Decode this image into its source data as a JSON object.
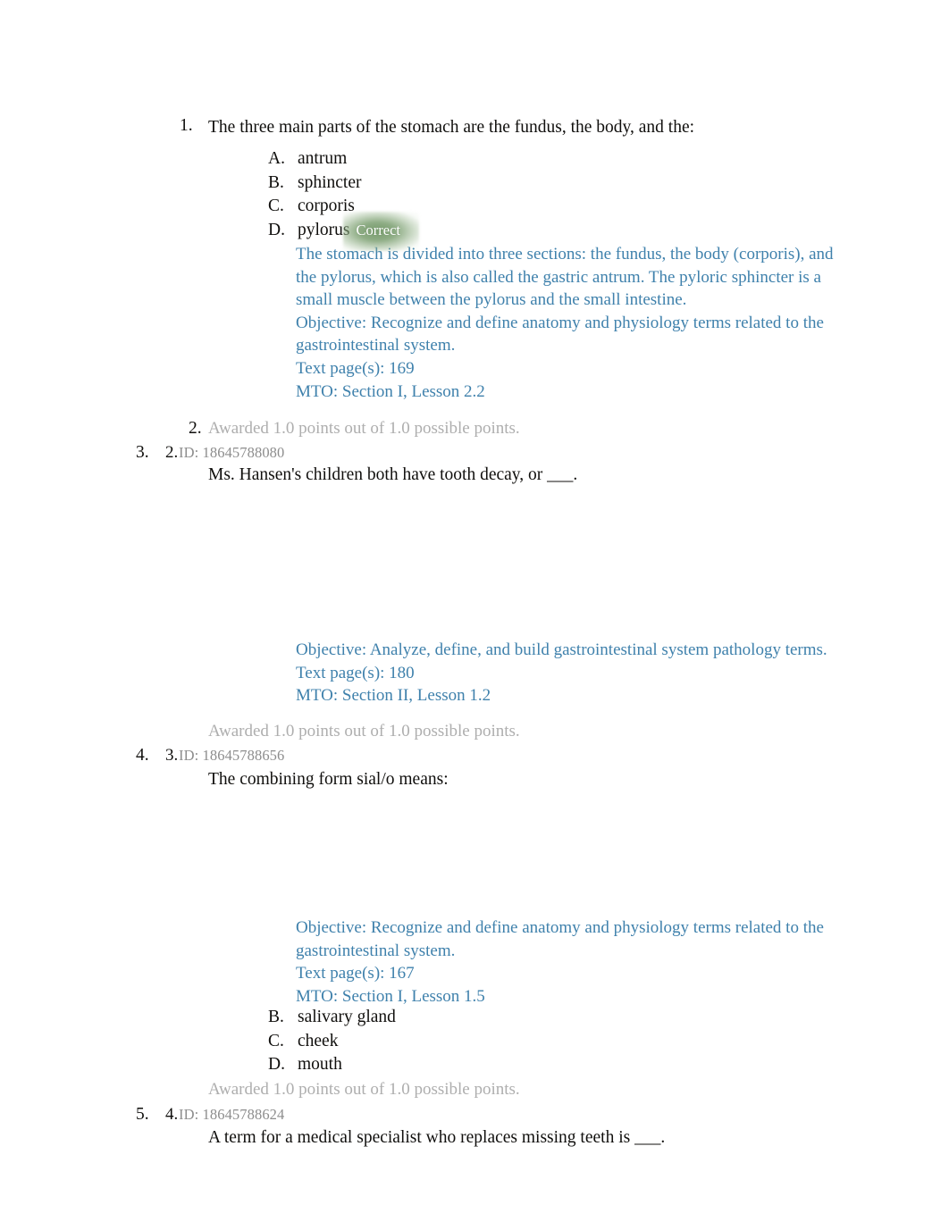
{
  "document": {
    "type": "quiz-review",
    "colors": {
      "rationale_blue": "#3f81ac",
      "awarded_gray": "#aeaeae",
      "id_gray": "#8d8d8d",
      "correct_badge_green": "#709665",
      "body_text": "#100f0d",
      "page_background": "#ffffff"
    }
  },
  "questions": [
    {
      "outer_marker": "1.",
      "stem": "The three main parts of the stomach are the fundus, the body, and the:",
      "options": [
        {
          "letter": "A.",
          "text": "antrum"
        },
        {
          "letter": "B.",
          "text": "sphincter"
        },
        {
          "letter": "C.",
          "text": "corporis"
        },
        {
          "letter": "D.",
          "text": "pylorus",
          "badge": "Correct"
        }
      ],
      "rationale": "The stomach is divided into three sections: the fundus, the body (corporis), and the pylorus, which is also called the gastric antrum. The pyloric sphincter is a small muscle between the pylorus and the small intestine.",
      "objective": "Objective: Recognize and define anatomy and physiology terms related to the gastrointestinal system.",
      "text_pages": "Text page(s): 169",
      "mto": "MTO: Section I, Lesson 2.2",
      "awarded_marker": "2.",
      "awarded": "Awarded 1.0 points out of 1.0 possible points."
    },
    {
      "outer_marker": "3.",
      "inner_marker": "2.",
      "id": "ID: 18645788080",
      "stem": "Ms. Hansen's children both have tooth decay, or ___.",
      "objective": "Objective: Analyze, define, and build gastrointestinal system pathology terms.",
      "text_pages": "Text page(s): 180",
      "mto": "MTO: Section II, Lesson 1.2",
      "awarded": "Awarded 1.0 points out of 1.0 possible points."
    },
    {
      "outer_marker": "4.",
      "inner_marker": "3.",
      "id": "ID: 18645788656",
      "stem": "The combining form sial/o  means:",
      "objective": "Objective: Recognize and define anatomy and physiology terms related to the gastrointestinal system.",
      "text_pages": "Text page(s): 167",
      "mto": "MTO: Section I, Lesson 1.5",
      "options": [
        {
          "letter": "B.",
          "text": "salivary gland"
        },
        {
          "letter": "C.",
          "text": "cheek"
        },
        {
          "letter": "D.",
          "text": "mouth"
        }
      ],
      "awarded": "Awarded 1.0 points out of 1.0 possible points."
    },
    {
      "outer_marker": "5.",
      "inner_marker": "4.",
      "id": "ID: 18645788624",
      "stem": "A term for a medical specialist who replaces missing teeth is ___."
    }
  ]
}
